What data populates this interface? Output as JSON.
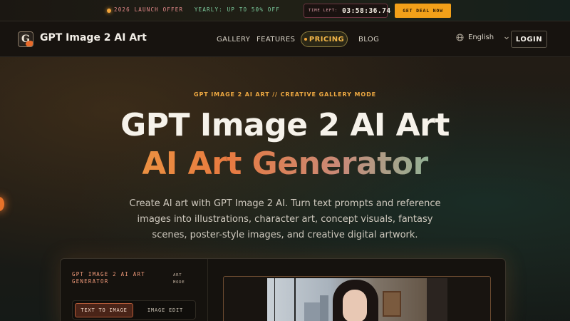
{
  "promo": {
    "launch": "2026 LAUNCH OFFER",
    "yearly": "YEARLY: UP TO 50% OFF",
    "timer_label": "TIME LEFT:",
    "timer_value": "03:58:36.74",
    "deal_button": "GET DEAL NOW"
  },
  "nav": {
    "brand": "GPT Image 2 AI Art",
    "links": [
      "GALLERY",
      "FEATURES",
      "PRICING",
      "BLOG"
    ],
    "language": "English",
    "login": "LOGIN"
  },
  "hero": {
    "tagline": "GPT IMAGE 2 AI ART // CREATIVE GALLERY MODE",
    "title": "GPT Image 2 AI Art",
    "subtitle": "AI Art Generator",
    "description": "Create AI art with GPT Image 2 AI. Turn text prompts and reference images into illustrations, character art, concept visuals, fantasy scenes, poster-style images, and creative digital artwork."
  },
  "generator": {
    "title": "GPT IMAGE 2 AI ART GENERATOR",
    "mode": "ART MODE",
    "tabs": [
      "TEXT TO IMAGE",
      "IMAGE EDIT"
    ],
    "active_tab": "TEXT TO IMAGE"
  },
  "colors": {
    "accent": "#f2a019",
    "pricing": "#f2b548",
    "gradient": [
      "#f1b544",
      "#e87a40",
      "#6fcaa8",
      "#57c8b4"
    ]
  },
  "icons": {
    "logo": "g-logo-icon",
    "globe": "globe-icon",
    "chevron": "chevron-down-icon"
  }
}
